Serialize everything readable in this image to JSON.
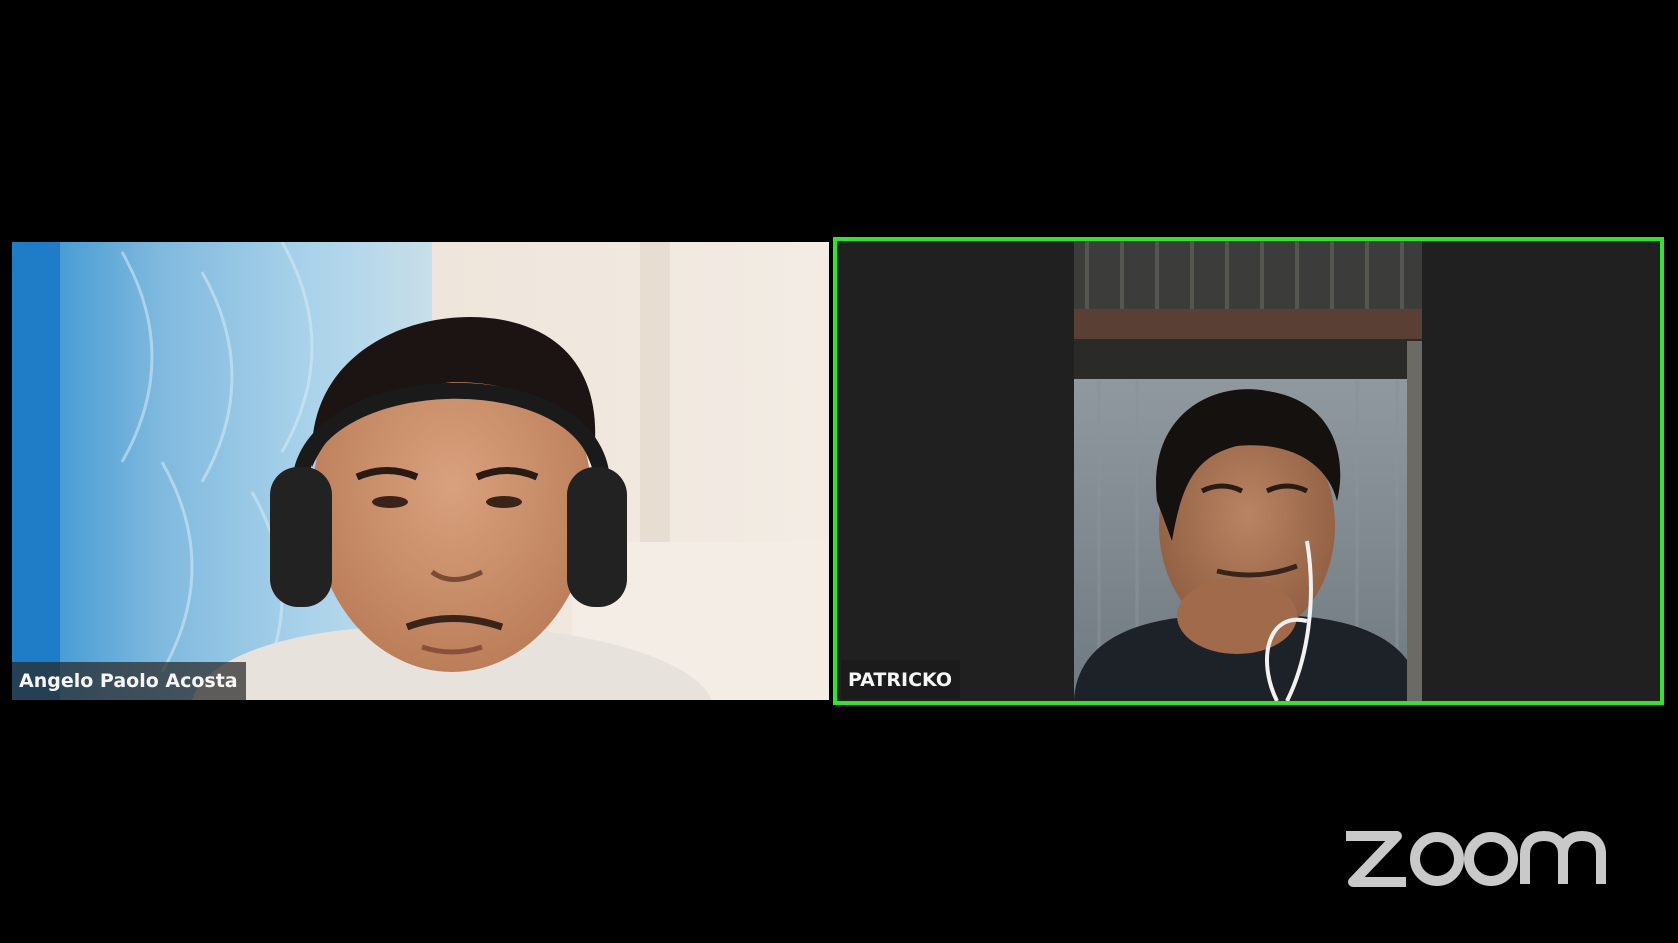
{
  "meeting": {
    "participants": [
      {
        "name": "Angelo Paolo Acosta",
        "active_speaker": false
      },
      {
        "name": "PATRICKO",
        "active_speaker": true
      }
    ],
    "brand": "zoom"
  },
  "colors": {
    "background": "#000000",
    "active_speaker_border": "#2ee62e",
    "name_tag_text": "#f5f5f5",
    "logo": "#c9c9c9"
  },
  "icons": {
    "logo": "zoom-logo"
  }
}
